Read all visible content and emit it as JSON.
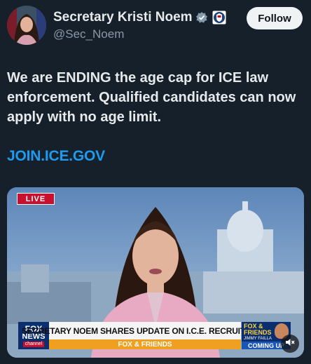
{
  "author": {
    "display_name": "Secretary Kristi Noem",
    "handle": "@Sec_Noem",
    "verified_icon": "verified-badge-icon",
    "affiliation_icon": "dhs-seal-icon"
  },
  "actions": {
    "follow_label": "Follow"
  },
  "tweet": {
    "text": "We are ENDING the age cap for ICE law enforcement. Qualified candidates can now apply with no age limit.",
    "link_text": "JOIN.ICE.GOV"
  },
  "video": {
    "live_label": "LIVE",
    "network": {
      "line1": "FOX",
      "line2": "NEWS",
      "line3": "channel"
    },
    "headline": "SECRETARY NOEM SHARES UPDATE ON I.C.E. RECRUITMENT",
    "subbar": "FOX & FRIENDS",
    "show_bug": {
      "title": "FOX & FRIENDS",
      "sub": "JIMMY FAILLA",
      "coming_label": "COMING UP"
    },
    "mute_icon": "speaker-muted-icon"
  },
  "colors": {
    "background": "#15202b",
    "link": "#1d9bf0",
    "follow_bg": "#eff3f4",
    "live_red": "#c8102e",
    "fox_navy": "#0a2e6e"
  }
}
